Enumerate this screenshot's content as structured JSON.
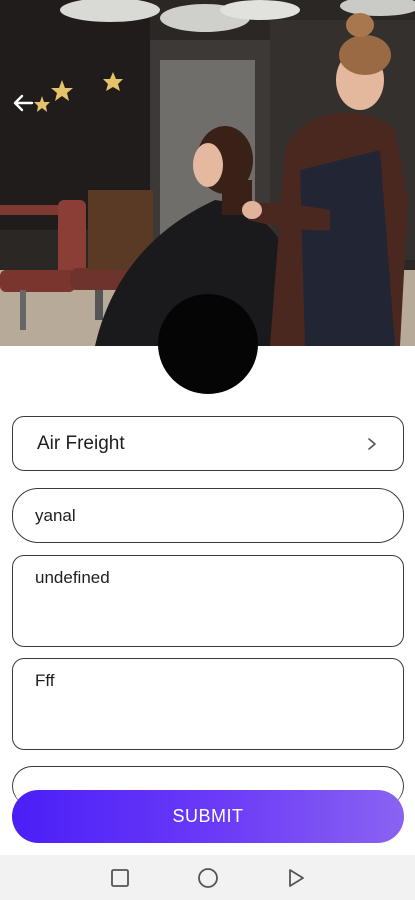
{
  "header": {
    "photo_icon": "hair-salon-photo",
    "back_icon": "arrow-left-icon"
  },
  "avatar": {
    "icon": "profile-avatar"
  },
  "form": {
    "service_select": {
      "value": "Air Freight",
      "icon": "chevron-right-icon"
    },
    "name_field": {
      "value": "yanal"
    },
    "details_field": {
      "value": "undefined"
    },
    "notes_field": {
      "value": "Fff"
    }
  },
  "actions": {
    "submit_label": "SUBMIT"
  },
  "system_nav": {
    "recents_icon": "square-icon",
    "home_icon": "circle-icon",
    "back_icon": "triangle-back-icon"
  },
  "colors": {
    "primary_start": "#4a1ff7",
    "primary_end": "#8a63f2",
    "border": "#3a3a3a"
  }
}
